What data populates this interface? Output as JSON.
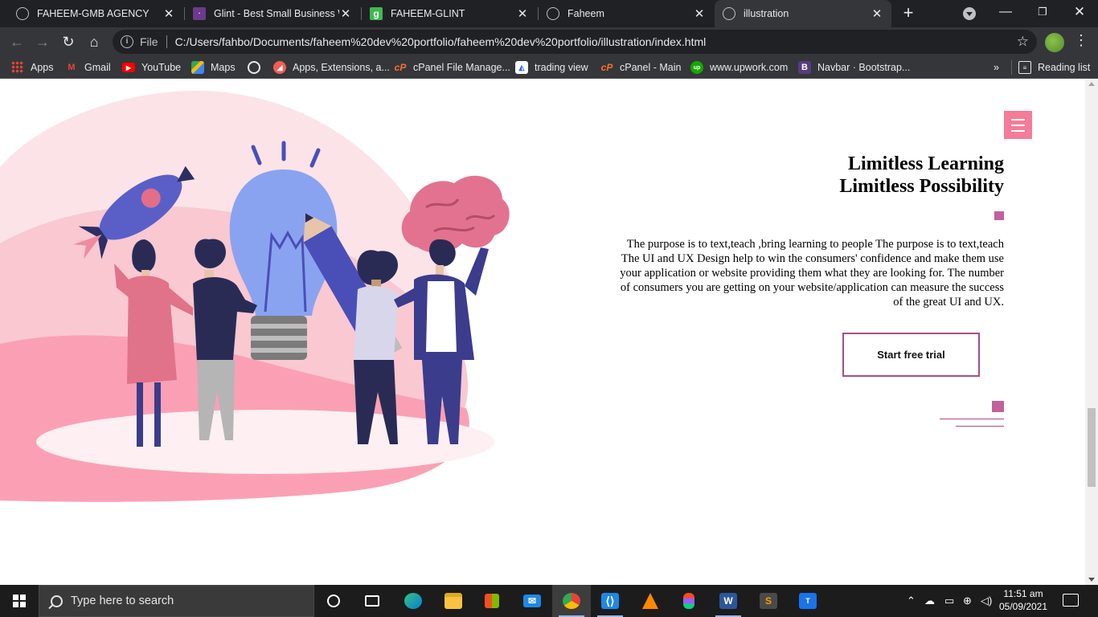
{
  "browser": {
    "tabs": [
      {
        "title": "FAHEEM-GMB AGENCY",
        "icon": "globe-icon",
        "active": false
      },
      {
        "title": "Glint - Best Small Business W",
        "icon": "colorlib-icon",
        "active": false
      },
      {
        "title": "FAHEEM-GLINT",
        "icon": "glitch-icon",
        "active": false
      },
      {
        "title": "Faheem",
        "icon": "globe-icon",
        "active": false
      },
      {
        "title": "illustration",
        "icon": "globe-icon",
        "active": true
      }
    ],
    "address": {
      "scheme_label": "File",
      "url": "C:/Users/fahbo/Documents/faheem%20dev%20portfolio/faheem%20dev%20portfolio/illustration/index.html"
    },
    "bookmarks": [
      {
        "label": "Apps",
        "icon": "apps-grid-icon"
      },
      {
        "label": "Gmail",
        "icon": "gmail-icon"
      },
      {
        "label": "YouTube",
        "icon": "youtube-icon"
      },
      {
        "label": "Maps",
        "icon": "maps-icon"
      },
      {
        "label": "",
        "icon": "globe-icon"
      },
      {
        "label": "Apps, Extensions, a...",
        "icon": "extensions-icon"
      },
      {
        "label": "cPanel File Manage...",
        "icon": "cpanel-icon"
      },
      {
        "label": "trading view",
        "icon": "tradingview-icon"
      },
      {
        "label": "cPanel - Main",
        "icon": "cpanel-icon"
      },
      {
        "label": "www.upwork.com",
        "icon": "upwork-icon"
      },
      {
        "label": "Navbar · Bootstrap...",
        "icon": "bootstrap-icon"
      }
    ],
    "more_bookmarks": "»",
    "reading_list": "Reading list"
  },
  "page": {
    "heading_line1": "Limitless Learning",
    "heading_line2": "Limitless Possibility",
    "description_lines": [
      "The purpose is to text,teach ,bring learning to people The purpose is to text,teach",
      "The UI and UX Design help to win the consumers' confidence and make them use",
      "your application or website providing them what they are looking for. The number",
      "of consumers you are getting on your website/application can measure the success",
      "of the great UI and UX."
    ],
    "cta_label": "Start free trial",
    "colors": {
      "accent": "#f47c99",
      "square": "#c2619b",
      "border": "#a34f8a"
    }
  },
  "taskbar": {
    "search_placeholder": "Type here to search",
    "time": "11:51 am",
    "date": "05/09/2021"
  }
}
